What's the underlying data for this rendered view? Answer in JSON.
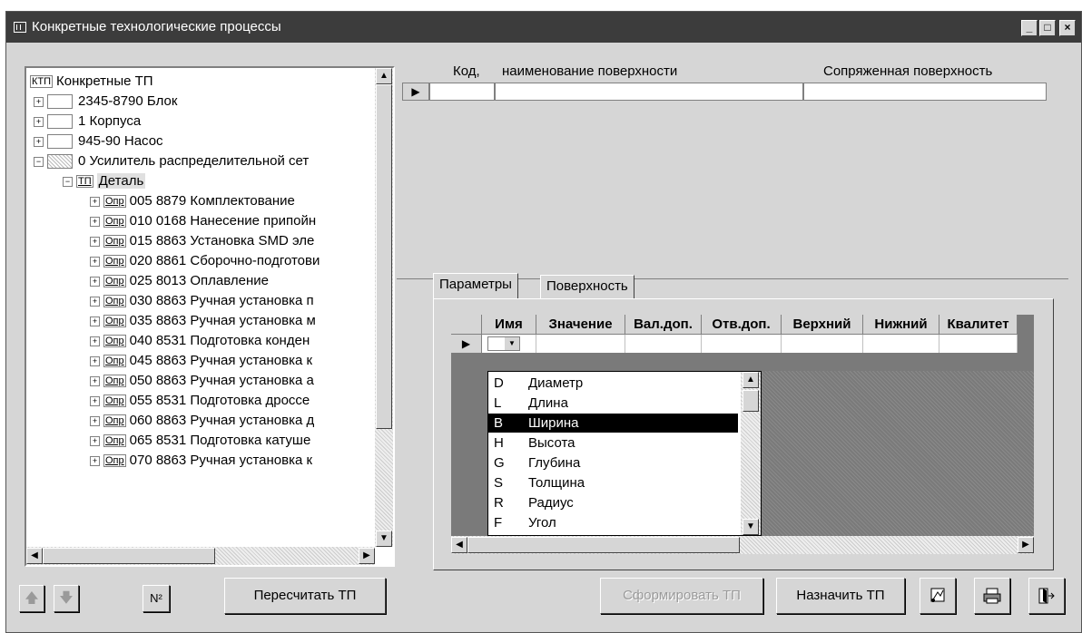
{
  "window": {
    "title": "Конкретные технологические процессы",
    "minimize": "_",
    "maximize": "□",
    "close": "×"
  },
  "tree": {
    "root_tag": "КТП",
    "root_label": "Конкретные ТП",
    "items": [
      {
        "expander": "+",
        "label": "2345-8790 Блок"
      },
      {
        "expander": "+",
        "label": "1 Корпуса"
      },
      {
        "expander": "+",
        "label": "945-90 Насос"
      },
      {
        "expander": "−",
        "label": "0 Усилитель распределительной сет"
      }
    ],
    "tp_tag": "ТП",
    "tp_label": "Деталь",
    "op_tag": "Опр",
    "operations": [
      "005  8879 Комплектование",
      "010  0168 Нанесение припойн",
      "015  8863 Установка SMD эле",
      "020  8861 Сборочно-подготови",
      "025  8013 Оплавление",
      "030  8863 Ручная установка п",
      "035  8863 Ручная установка м",
      "040  8531 Подготовка конден",
      "045  8863 Ручная установка к",
      "050  8863 Ручная установка а",
      "055  8531 Подготовка дроссе",
      "060  8863 Ручная установка д",
      "065  8531 Подготовка катуше",
      "070  8863 Ручная установка к"
    ]
  },
  "surfaces": {
    "col_code": "Код,",
    "col_name": "наименование поверхности",
    "col_mated": "Сопряженная поверхность"
  },
  "tabs": [
    "Параметры",
    "Поверхность"
  ],
  "params_grid": {
    "columns": [
      "Имя",
      "Значение",
      "Вал.доп.",
      "Отв.доп.",
      "Верхний",
      "Нижний",
      "Квалитет"
    ]
  },
  "dropdown": {
    "items": [
      {
        "code": "D",
        "name": "Диаметр"
      },
      {
        "code": "L",
        "name": "Длина"
      },
      {
        "code": "B",
        "name": "Ширина"
      },
      {
        "code": "H",
        "name": "Высота"
      },
      {
        "code": "G",
        "name": "Глубина"
      },
      {
        "code": "S",
        "name": "Толщина"
      },
      {
        "code": "R",
        "name": "Радиус"
      },
      {
        "code": "F",
        "name": "Угол"
      }
    ],
    "selected_index": 2
  },
  "buttons": {
    "number": "N²",
    "recalc": "Пересчитать ТП",
    "form": "Сформировать ТП",
    "assign": "Назначить ТП"
  },
  "icons": {
    "up": "arrow-up-icon",
    "down": "arrow-down-icon",
    "tools": "tools-icon",
    "print": "printer-icon",
    "exit": "exit-icon"
  }
}
